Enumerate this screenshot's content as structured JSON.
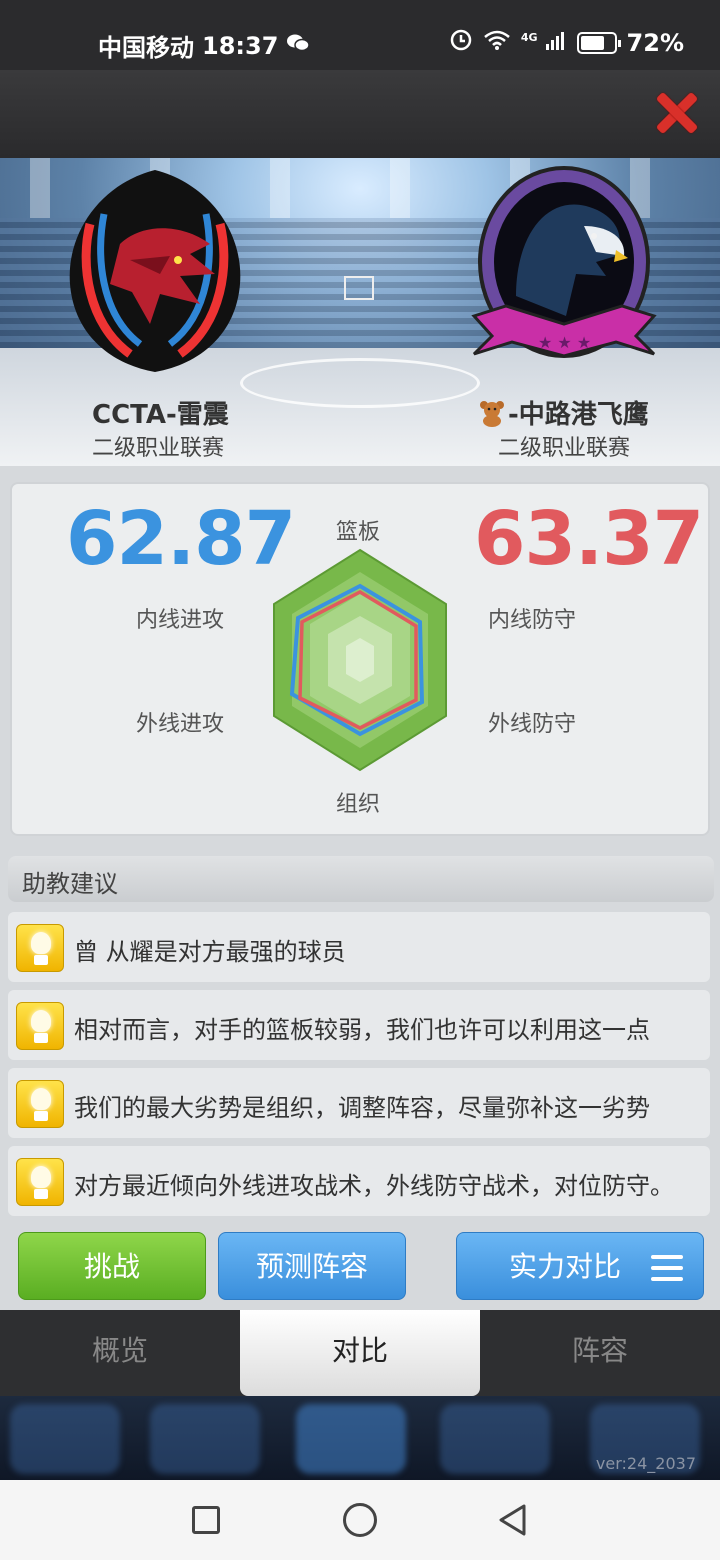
{
  "status_bar": {
    "carrier": "中国移动",
    "time": "18:37",
    "network": "4G",
    "battery": "72%",
    "battery_level": 0.72
  },
  "window": {
    "close_icon": "close-x-icon"
  },
  "teams": {
    "home": {
      "name": "CCTA-雷震",
      "league": "二级职业联赛",
      "logo": "red-dragon-logo"
    },
    "away": {
      "name": "-中路港飞鹰",
      "prefix_icon": "teddy-bear-icon",
      "league": "二级职业联赛",
      "logo": "purple-eagle-logo"
    }
  },
  "stats": {
    "home_score": "62.87",
    "away_score": "63.37",
    "axes": {
      "top": "篮板",
      "upper_left": "内线进攻",
      "upper_right": "内线防守",
      "lower_left": "外线进攻",
      "lower_right": "外线防守",
      "bottom": "组织"
    },
    "colors": {
      "home": "#3b93df",
      "away": "#e15a5e",
      "radar_fill": "#7dbb48"
    }
  },
  "advice": {
    "header": "助教建议",
    "items": [
      "曾 从耀是对方最强的球员",
      "相对而言，对手的篮板较弱，我们也许可以利用这一点",
      "我们的最大劣势是组织，调整阵容，尽量弥补这一劣势",
      "对方最近倾向外线进攻战术，外线防守战术，对位防守。"
    ]
  },
  "buttons": {
    "challenge": "挑战",
    "predict_lineup": "预测阵容",
    "strength_compare": "实力对比"
  },
  "tabs": [
    {
      "label": "概览",
      "active": false
    },
    {
      "label": "对比",
      "active": true
    },
    {
      "label": "阵容",
      "active": false
    }
  ],
  "version": "ver:24_2037"
}
